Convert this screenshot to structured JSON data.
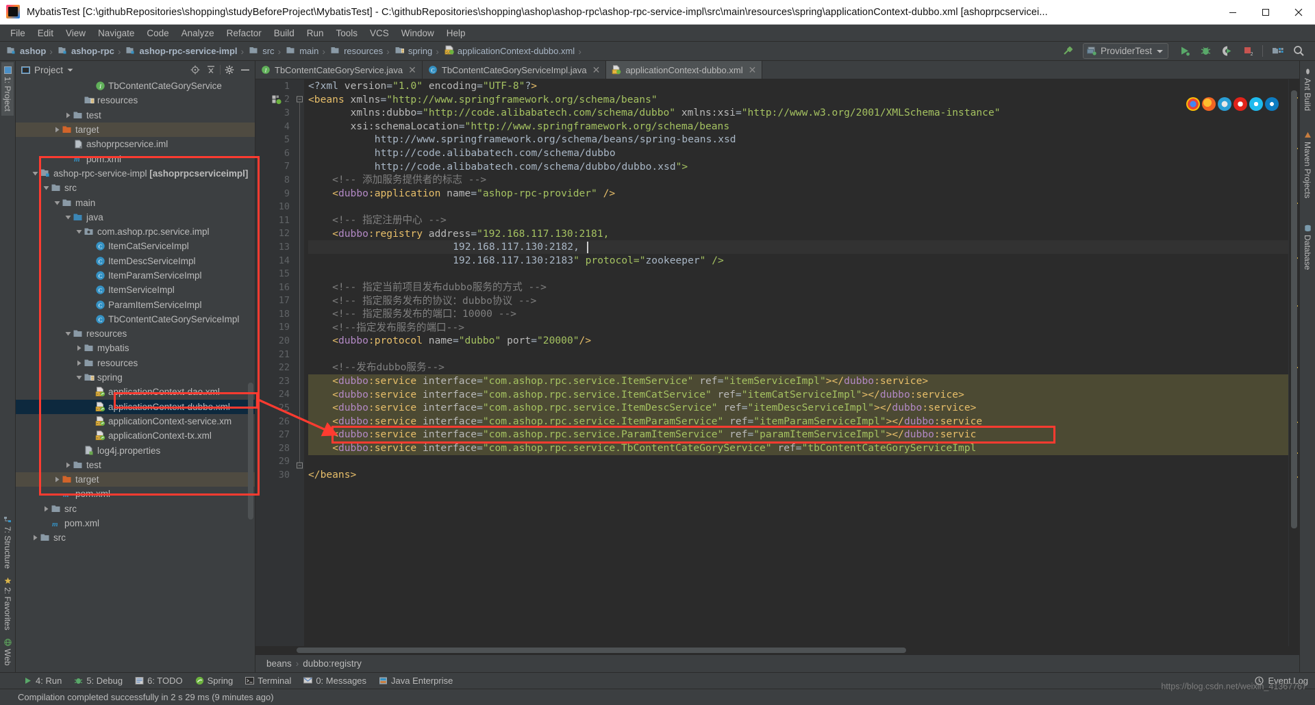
{
  "window": {
    "title": "MybatisTest [C:\\githubRepositories\\shopping\\studyBeforeProject\\MybatisTest] - C:\\githubRepositories\\shopping\\ashop\\ashop-rpc\\ashop-rpc-service-impl\\src\\main\\resources\\spring\\applicationContext-dubbo.xml [ashoprpcservicei...",
    "minimize": "minimize-button",
    "maximize": "maximize-button",
    "close": "close-button"
  },
  "menubar": {
    "items": [
      "File",
      "Edit",
      "View",
      "Navigate",
      "Code",
      "Analyze",
      "Refactor",
      "Build",
      "Run",
      "Tools",
      "VCS",
      "Window",
      "Help"
    ]
  },
  "navbar": {
    "crumbs": [
      {
        "label": "ashop",
        "icon": "module-folder-icon"
      },
      {
        "label": "ashop-rpc",
        "icon": "module-folder-icon"
      },
      {
        "label": "ashop-rpc-service-impl",
        "icon": "module-folder-icon"
      },
      {
        "label": "src",
        "icon": "folder-icon"
      },
      {
        "label": "main",
        "icon": "folder-icon"
      },
      {
        "label": "resources",
        "icon": "folder-icon"
      },
      {
        "label": "spring",
        "icon": "resource-folder-icon"
      },
      {
        "label": "applicationContext-dubbo.xml",
        "icon": "spring-xml-icon"
      }
    ],
    "run_config": "ProviderTest",
    "buttons": [
      "build-hammer-icon",
      "run-icon",
      "debug-icon",
      "run-with-coverage-icon",
      "stop-icon",
      "project-structure-icon",
      "search-everywhere-icon"
    ]
  },
  "left_strips": {
    "top": [
      {
        "label": "1: Project",
        "icon": "project-icon"
      }
    ],
    "bottom": [
      {
        "label": "7: Structure",
        "icon": "structure-icon"
      },
      {
        "label": "2: Favorites",
        "icon": "star-icon"
      },
      {
        "label": "Web",
        "icon": "web-icon"
      }
    ]
  },
  "right_strips": {
    "items": [
      {
        "label": "Ant Build",
        "icon": "ant-icon"
      },
      {
        "label": "Maven Projects",
        "icon": "maven-icon"
      },
      {
        "label": "Database",
        "icon": "database-icon"
      }
    ]
  },
  "project_panel": {
    "title": "Project",
    "header_icons": [
      "locate-icon",
      "collapse-all-icon",
      "gear-icon",
      "hide-icon"
    ],
    "tree": [
      {
        "label": "TbContentCateGoryService",
        "indent": 7,
        "icon": "interface-icon",
        "arrow": "none"
      },
      {
        "label": "resources",
        "indent": 6,
        "icon": "resource-folder-icon",
        "arrow": "none"
      },
      {
        "label": "test",
        "indent": 5,
        "icon": "folder-icon",
        "arrow": "collapsed"
      },
      {
        "label": "target",
        "indent": 4,
        "icon": "target-folder-icon",
        "arrow": "collapsed",
        "state": "amber"
      },
      {
        "label": "ashoprpcservice.iml",
        "indent": 5,
        "icon": "iml-icon",
        "arrow": "none"
      },
      {
        "label": "pom.xml",
        "indent": 5,
        "icon": "maven-pom-icon",
        "arrow": "none"
      },
      {
        "label": "ashop-rpc-service-impl",
        "suffix": " [ashoprpcserviceimpl]",
        "indent": 2,
        "icon": "module-folder-icon",
        "arrow": "expanded"
      },
      {
        "label": "src",
        "indent": 3,
        "icon": "folder-icon",
        "arrow": "expanded"
      },
      {
        "label": "main",
        "indent": 4,
        "icon": "folder-icon",
        "arrow": "expanded"
      },
      {
        "label": "java",
        "indent": 5,
        "icon": "source-folder-icon",
        "arrow": "expanded"
      },
      {
        "label": "com.ashop.rpc.service.impl",
        "indent": 6,
        "icon": "package-icon",
        "arrow": "expanded"
      },
      {
        "label": "ItemCatServiceImpl",
        "indent": 7,
        "icon": "class-icon",
        "arrow": "none"
      },
      {
        "label": "ItemDescServiceImpl",
        "indent": 7,
        "icon": "class-icon",
        "arrow": "none"
      },
      {
        "label": "ItemParamServiceImpl",
        "indent": 7,
        "icon": "class-icon",
        "arrow": "none"
      },
      {
        "label": "ItemServiceImpl",
        "indent": 7,
        "icon": "class-icon",
        "arrow": "none"
      },
      {
        "label": "ParamItemServiceImpl",
        "indent": 7,
        "icon": "class-icon",
        "arrow": "none"
      },
      {
        "label": "TbContentCateGoryServiceImpl",
        "indent": 7,
        "icon": "class-icon",
        "arrow": "none"
      },
      {
        "label": "resources",
        "indent": 5,
        "icon": "folder-icon",
        "arrow": "expanded"
      },
      {
        "label": "mybatis",
        "indent": 6,
        "icon": "folder-icon",
        "arrow": "collapsed"
      },
      {
        "label": "resources",
        "indent": 6,
        "icon": "folder-icon",
        "arrow": "collapsed"
      },
      {
        "label": "spring",
        "indent": 6,
        "icon": "resource-folder-icon",
        "arrow": "expanded"
      },
      {
        "label": "applicationContext-dao.xml",
        "indent": 7,
        "icon": "spring-xml-icon",
        "arrow": "none"
      },
      {
        "label": "applicationContext-dubbo.xml",
        "indent": 7,
        "icon": "spring-xml-icon",
        "arrow": "none",
        "state": "blue"
      },
      {
        "label": "applicationContext-service.xm",
        "indent": 7,
        "icon": "spring-xml-icon",
        "arrow": "none"
      },
      {
        "label": "applicationContext-tx.xml",
        "indent": 7,
        "icon": "spring-xml-icon",
        "arrow": "none"
      },
      {
        "label": "log4j.properties",
        "indent": 6,
        "icon": "properties-icon",
        "arrow": "none"
      },
      {
        "label": "test",
        "indent": 5,
        "icon": "folder-icon",
        "arrow": "collapsed"
      },
      {
        "label": "target",
        "indent": 4,
        "icon": "target-folder-icon",
        "arrow": "collapsed",
        "state": "amber"
      },
      {
        "label": "pom.xml",
        "indent": 4,
        "icon": "maven-pom-icon",
        "arrow": "none"
      },
      {
        "label": "src",
        "indent": 3,
        "icon": "folder-icon",
        "arrow": "collapsed"
      },
      {
        "label": "pom.xml",
        "indent": 3,
        "icon": "maven-pom-icon",
        "arrow": "none"
      },
      {
        "label": "src",
        "indent": 2,
        "icon": "folder-icon",
        "arrow": "collapsed"
      }
    ]
  },
  "editor": {
    "tabs": [
      {
        "label": "TbContentCateGoryService.java",
        "icon": "interface-icon",
        "active": false
      },
      {
        "label": "TbContentCateGoryServiceImpl.java",
        "icon": "class-icon",
        "active": false
      },
      {
        "label": "applicationContext-dubbo.xml",
        "icon": "spring-xml-icon",
        "active": true
      }
    ],
    "breadcrumb": [
      "beans",
      "dubbo:registry"
    ],
    "first_line": 1,
    "last_line": 30,
    "lines": [
      {
        "n": 1,
        "text": "<?xml version=\"1.0\" encoding=\"UTF-8\"?>"
      },
      {
        "n": 2,
        "text": "<beans xmlns=\"http://www.springframework.org/schema/beans\""
      },
      {
        "n": 3,
        "text": "       xmlns:dubbo=\"http://code.alibabatech.com/schema/dubbo\" xmlns:xsi=\"http://www.w3.org/2001/XMLSchema-instance\""
      },
      {
        "n": 4,
        "text": "       xsi:schemaLocation=\"http://www.springframework.org/schema/beans"
      },
      {
        "n": 5,
        "text": "           http://www.springframework.org/schema/beans/spring-beans.xsd"
      },
      {
        "n": 6,
        "text": "           http://code.alibabatech.com/schema/dubbo"
      },
      {
        "n": 7,
        "text": "           http://code.alibabatech.com/schema/dubbo/dubbo.xsd\">"
      },
      {
        "n": 8,
        "text": "    <!-- 添加服务提供者的标志 -->"
      },
      {
        "n": 9,
        "text": "    <dubbo:application name=\"ashop-rpc-provider\" />"
      },
      {
        "n": 10,
        "text": ""
      },
      {
        "n": 11,
        "text": "    <!-- 指定注册中心 -->"
      },
      {
        "n": 12,
        "text": "    <dubbo:registry address=\"192.168.117.130:2181,"
      },
      {
        "n": 13,
        "text": "                        192.168.117.130:2182,"
      },
      {
        "n": 14,
        "text": "                        192.168.117.130:2183\" protocol=\"zookeeper\" />"
      },
      {
        "n": 15,
        "text": ""
      },
      {
        "n": 16,
        "text": "    <!-- 指定当前项目发布dubbo服务的方式 -->"
      },
      {
        "n": 17,
        "text": "    <!-- 指定服务发布的协议：dubbo协议 -->"
      },
      {
        "n": 18,
        "text": "    <!-- 指定服务发布的端口：10000 -->"
      },
      {
        "n": 19,
        "text": "    <!--指定发布服务的端口-->"
      },
      {
        "n": 20,
        "text": "    <dubbo:protocol name=\"dubbo\" port=\"20000\"/>"
      },
      {
        "n": 21,
        "text": ""
      },
      {
        "n": 22,
        "text": "    <!--发布dubbo服务-->"
      },
      {
        "n": 23,
        "text": "    <dubbo:service interface=\"com.ashop.rpc.service.ItemService\" ref=\"itemServiceImpl\"></dubbo:service>"
      },
      {
        "n": 24,
        "text": "    <dubbo:service interface=\"com.ashop.rpc.service.ItemCatService\" ref=\"itemCatServiceImpl\"></dubbo:service>"
      },
      {
        "n": 25,
        "text": "    <dubbo:service interface=\"com.ashop.rpc.service.ItemDescService\" ref=\"itemDescServiceImpl\"></dubbo:service>"
      },
      {
        "n": 26,
        "text": "    <dubbo:service interface=\"com.ashop.rpc.service.ItemParamService\" ref=\"itemParamServiceImpl\"></dubbo:service"
      },
      {
        "n": 27,
        "text": "    <dubbo:service interface=\"com.ashop.rpc.service.ParamItemService\" ref=\"paramItemServiceImpl\"></dubbo:servic"
      },
      {
        "n": 28,
        "text": "    <dubbo:service interface=\"com.ashop.rpc.service.TbContentCateGoryService\" ref=\"tbContentCateGoryServiceImpl"
      },
      {
        "n": 29,
        "text": ""
      },
      {
        "n": 30,
        "text": "</beans>"
      }
    ]
  },
  "bottom_bar": {
    "tabs": [
      {
        "label": "4: Run",
        "icon": "run-icon",
        "accel": "4"
      },
      {
        "label": "5: Debug",
        "icon": "debug-icon",
        "accel": "5"
      },
      {
        "label": "6: TODO",
        "icon": "todo-icon",
        "accel": "6"
      },
      {
        "label": "Spring",
        "icon": "spring-icon",
        "accel": ""
      },
      {
        "label": "Terminal",
        "icon": "terminal-icon",
        "accel": ""
      },
      {
        "label": "0: Messages",
        "icon": "messages-icon",
        "accel": "0"
      },
      {
        "label": "Java Enterprise",
        "icon": "java-ee-icon",
        "accel": ""
      }
    ],
    "event_log": "Event Log"
  },
  "statusbar": {
    "message": "Compilation completed successfully in 2 s 29 ms (9 minutes ago)"
  },
  "overlay": {
    "watermark": "https://blog.csdn.net/weixin_41367767",
    "annotation_color": "#ff3b30"
  }
}
